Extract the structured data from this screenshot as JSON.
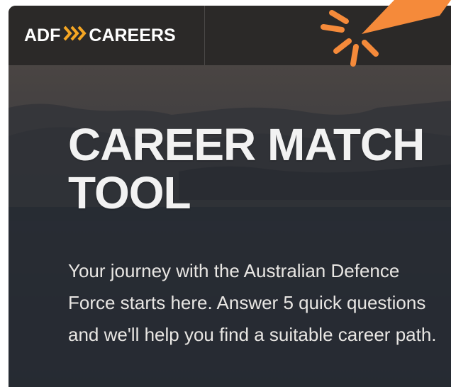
{
  "brand": {
    "left": "ADF",
    "right": "CAREERS",
    "chevron_color": "#f5a623"
  },
  "hero": {
    "title_line1": "CAREER MATCH",
    "title_line2": "TOOL",
    "description": "Your journey with the Australian Defence Force starts here. Answer 5 quick questions and we'll help you find a suitable career path."
  },
  "colors": {
    "accent": "#f58a3a",
    "header_bg": "#2b2928",
    "hero_bg": "#2a2e36"
  },
  "icons": {
    "logo_chevrons": "triple-chevron-icon",
    "click_burst": "click-burst-icon"
  }
}
